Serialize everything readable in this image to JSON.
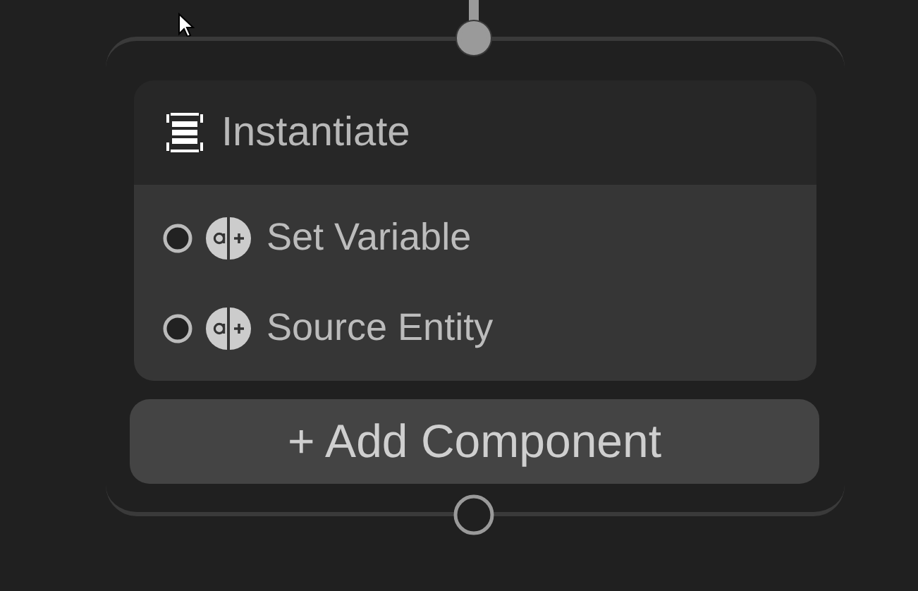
{
  "node": {
    "title": "Instantiate",
    "input_port": {
      "connected": true
    },
    "output_port": {
      "connected": false
    },
    "fields": [
      {
        "label": "Set Variable",
        "connected": false
      },
      {
        "label": "Source Entity",
        "connected": false
      }
    ],
    "add_button": "+ Add Component"
  }
}
